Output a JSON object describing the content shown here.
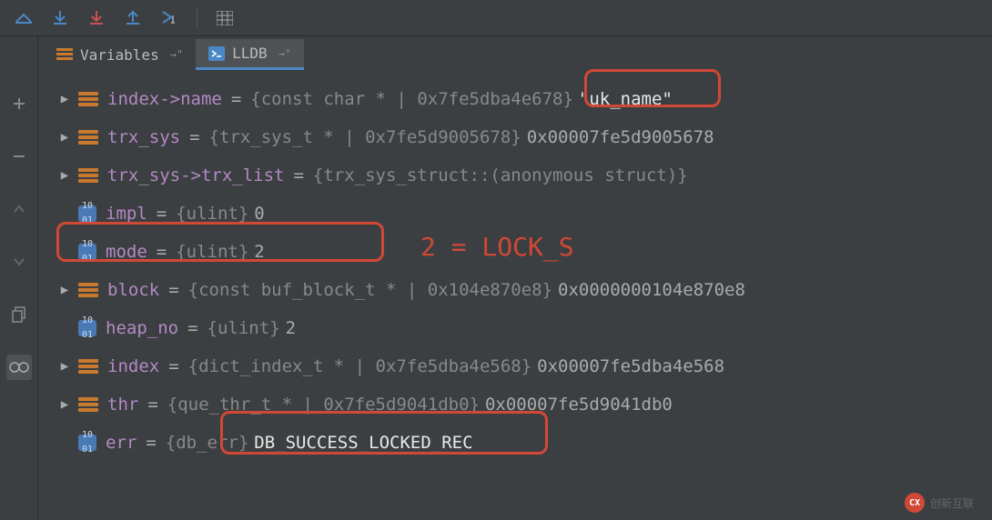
{
  "tabs": {
    "variables": {
      "label": "Variables"
    },
    "lldb": {
      "label": "LLDB"
    }
  },
  "rows": [
    {
      "name": "index->name",
      "type": "{const char * | 0x7fe5dba4e678}",
      "value": "\"uk_name\"",
      "icon": "struct",
      "expandable": true
    },
    {
      "name": "trx_sys",
      "type": "{trx_sys_t * | 0x7fe5d9005678}",
      "value": "0x00007fe5d9005678",
      "icon": "struct",
      "expandable": true
    },
    {
      "name": "trx_sys->trx_list",
      "type": "{trx_sys_struct::(anonymous struct)}",
      "value": "",
      "icon": "struct",
      "expandable": true
    },
    {
      "name": "impl",
      "type": "{ulint}",
      "value": "0",
      "icon": "prim",
      "expandable": false
    },
    {
      "name": "mode",
      "type": "{ulint}",
      "value": "2",
      "icon": "prim",
      "expandable": false
    },
    {
      "name": "block",
      "type": "{const buf_block_t * | 0x104e870e8}",
      "value": "0x0000000104e870e8",
      "icon": "struct",
      "expandable": true
    },
    {
      "name": "heap_no",
      "type": "{ulint}",
      "value": "2",
      "icon": "prim",
      "expandable": false
    },
    {
      "name": "index",
      "type": "{dict_index_t * | 0x7fe5dba4e568}",
      "value": "0x00007fe5dba4e568",
      "icon": "struct",
      "expandable": true
    },
    {
      "name": "thr",
      "type": "{que_thr_t * | 0x7fe5d9041db0}",
      "value": "0x00007fe5d9041db0",
      "icon": "struct",
      "expandable": true
    },
    {
      "name": "err",
      "type": "{db_err}",
      "value": "DB_SUCCESS_LOCKED_REC",
      "icon": "prim",
      "expandable": false
    }
  ],
  "annotations": {
    "lock_s": "2 = LOCK_S"
  },
  "watermark": {
    "logo": "CX",
    "text": "创新互联"
  }
}
